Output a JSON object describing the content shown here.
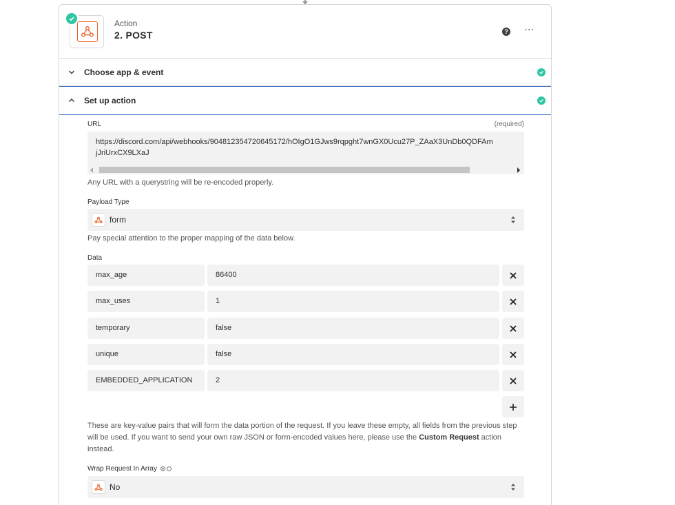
{
  "step": {
    "kind": "Action",
    "title": "2. POST"
  },
  "sections": {
    "choose": "Choose app & event",
    "setup": "Set up action"
  },
  "url_field": {
    "label": "URL",
    "required": "(required)",
    "value_line1": "https://discord.com/api/webhooks/904812354720645172/hOIgO1GJws9rqpght7wnGX0Ucu27P_ZAaX3UnDb0QDFAm",
    "value_line2": "jJriUrxCX9LXaJ",
    "hint": "Any URL with a querystring will be re-encoded properly."
  },
  "payload_type": {
    "label": "Payload Type",
    "value": "form",
    "hint": "Pay special attention to the proper mapping of the data below."
  },
  "data": {
    "label": "Data",
    "rows": [
      {
        "key": "max_age",
        "value": "86400"
      },
      {
        "key": "max_uses",
        "value": "1"
      },
      {
        "key": "temporary",
        "value": "false"
      },
      {
        "key": "unique",
        "value": "false"
      },
      {
        "key": "EMBEDDED_APPLICATION",
        "value": "2"
      }
    ],
    "description_1": "These are key-value pairs that will form the data portion of the request. If you leave these empty, all fields from the previous step will be used. If you want to send your own raw JSON or form-encoded values here, please use the ",
    "description_bold_1": "Custom Request",
    "description_2": " action instead."
  },
  "wrap_request": {
    "label": "Wrap Request In Array",
    "value": "No"
  },
  "icons": {
    "app": "webhook-icon",
    "accent": "#e8632c",
    "success": "#2ec6a1",
    "focus_border": "#3d73c4"
  }
}
